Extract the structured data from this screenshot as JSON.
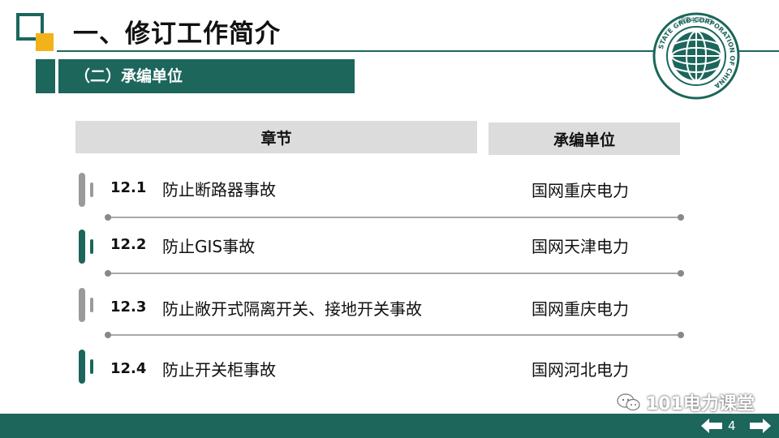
{
  "title": "一、修订工作简介",
  "subtitle": "（二）承编单位",
  "logo": {
    "text_top": "国家电网公司",
    "text_ring": "STATE GRID CORPORATION OF CHINA"
  },
  "table": {
    "headers": {
      "chapter": "章节",
      "unit": "承编单位"
    },
    "rows": [
      {
        "num": "12.1",
        "name": "防止断路器事故",
        "unit": "国网重庆电力",
        "bar_color": "#9a9a9a"
      },
      {
        "num": "12.2",
        "name": "防止GIS事故",
        "unit": "国网天津电力",
        "bar_color": "#1c665b"
      },
      {
        "num": "12.3",
        "name": "防止敞开式隔离开关、接地开关事故",
        "unit": "国网重庆电力",
        "bar_color": "#9a9a9a"
      },
      {
        "num": "12.4",
        "name": "防止开关柜事故",
        "unit": "国网河北电力",
        "bar_color": "#1c665b"
      }
    ]
  },
  "footer": {
    "page": "4",
    "watermark": "101电力课堂"
  },
  "colors": {
    "brand": "#1c665b",
    "accent": "#f2b21a",
    "header_bg": "#dcdcdc"
  }
}
